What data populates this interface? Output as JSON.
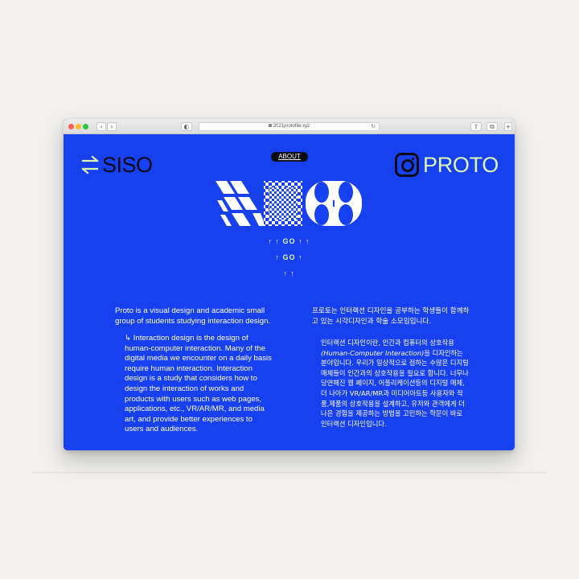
{
  "browser": {
    "url": "2021protofile.xyz",
    "back_label": "‹",
    "forward_label": "›",
    "sidebar_label": "◐",
    "share_label": "⇧",
    "tabs_label": "⧉",
    "reload_label": "↻"
  },
  "header": {
    "left_logo": "SISO",
    "right_logo": "PROTO",
    "about": "ABOUT"
  },
  "go": {
    "row1_pre": "↑ ↑ ",
    "row1_go": "GO",
    "row1_post": " ↑ ↑",
    "row2_pre": "↑ ",
    "row2_go": "GO",
    "row2_post": " ↑",
    "row3": "↑ ↑"
  },
  "content": {
    "en_intro": "Proto is a visual design and academic small group of students studying interaction design.",
    "en_body": "↳ Interaction design is the design of human-computer interaction. Many of the digital media we encounter on a daily basis require human interaction. Interaction design is a study that considers how to design the interaction of works and products with users such as web pages, applications, etc., VR/AR/MR, and media art, and provide better experiences to users and audiences.",
    "ko_intro": "프로토는 인터랙션 디자인을 공부하는 학생들이 함께하고 있는 시각디자인과 학술 소모임입니다.",
    "ko_body_1": "인터랙션 디자인이란, 인간과 컴퓨터의 상호작용",
    "ko_body_em": "(Human-Computer Interaction)",
    "ko_body_2": "을 디자인하는 분야입니다. 우리가 일상적으로 접하는 수많은 디지털 매체들이 인간과의 상호작용을 필요로 합니다. 너무나 당연해진 웹 페이지, 어플리케이션등의 디지털 매체, 더 나아가 VR/AR/MR과 미디어아트등 사용자와 작품,제품의 상호작용을 설계하고, 유저와 관객에게 더 나은 경험을 제공하는 방법을 고민하는 학문이 바로 인터랙션 디자인입니다."
  },
  "colors": {
    "background": "#1640f0",
    "accent": "#d9f7b2",
    "dark": "#0b0b16"
  }
}
